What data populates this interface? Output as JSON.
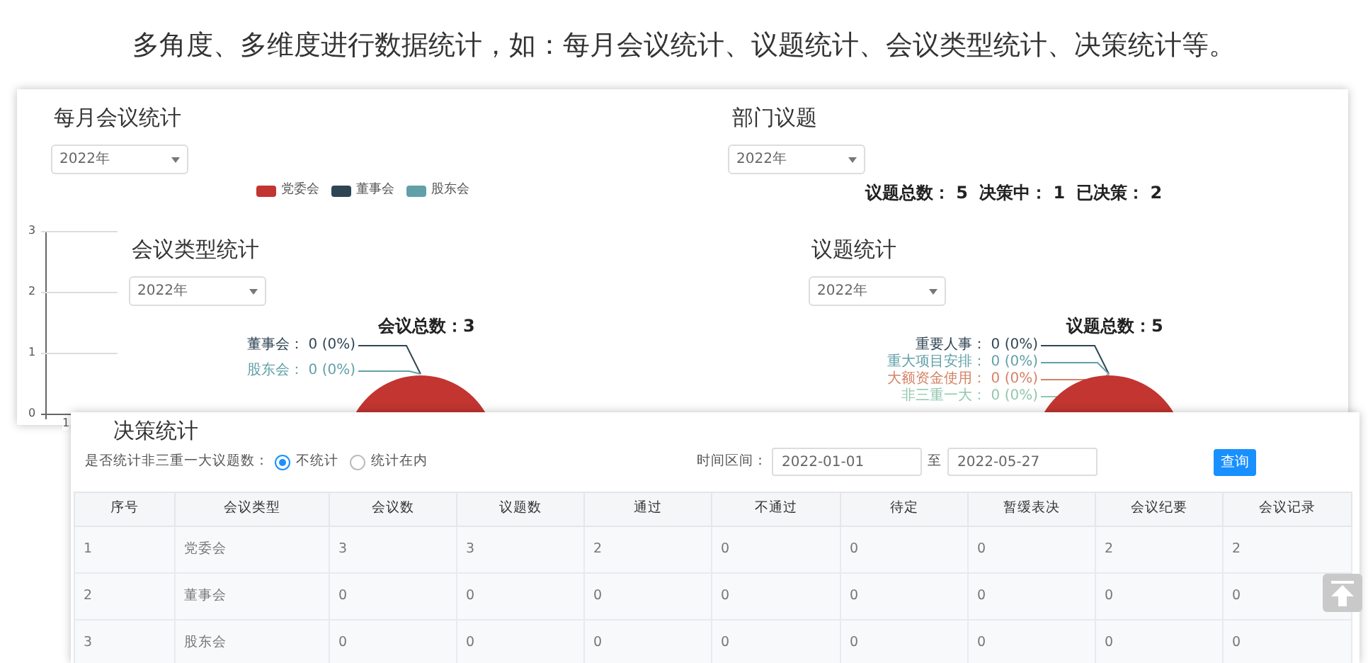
{
  "heading": "多角度、多维度进行数据统计，如：每月会议统计、议题统计、会议类型统计、决策统计等。",
  "monthly": {
    "title": "每月会议统计",
    "year_select": "2022年",
    "legend": [
      {
        "label": "党委会",
        "color": "#c23531"
      },
      {
        "label": "董事会",
        "color": "#2f4554"
      },
      {
        "label": "股东会",
        "color": "#61a0a8"
      }
    ],
    "y_axis_labels": [
      "3",
      "2",
      "1",
      "0"
    ],
    "x_axis_labels": [
      "1"
    ]
  },
  "department": {
    "title": "部门议题",
    "year_select": "2022年",
    "summary": [
      {
        "label": "议题总数：",
        "value": "5"
      },
      {
        "label": "决策中：",
        "value": "1"
      },
      {
        "label": "已决策：",
        "value": "2"
      }
    ]
  },
  "meeting_types": {
    "title": "会议类型统计",
    "year_select": "2022年",
    "total": "会议总数：3",
    "labels": [
      {
        "name": "董事会：",
        "value": "0 (0%)",
        "color": "#2f4554"
      },
      {
        "name": "股东会：",
        "value": "0 (0%)",
        "color": "#61a0a8"
      }
    ]
  },
  "topics": {
    "title": "议题统计",
    "year_select": "2022年",
    "total": "议题总数：5",
    "labels": [
      {
        "name": "重要人事：",
        "value": "0 (0%)",
        "color": "#2f4554"
      },
      {
        "name": "重大项目安排：",
        "value": "0 (0%)",
        "color": "#61a0a8"
      },
      {
        "name": "大额资金使用：",
        "value": "0 (0%)",
        "color": "#d48265"
      },
      {
        "name": "非三重一大：",
        "value": "0 (0%)",
        "color": "#91c7ae"
      }
    ]
  },
  "decisions": {
    "title": "决策统计",
    "filter_label": "是否统计非三重一大议题数：",
    "options": [
      {
        "label": "不统计",
        "selected": true
      },
      {
        "label": "统计在内",
        "selected": false
      }
    ],
    "range_label": "时间区间：",
    "start_date": "2022-01-01",
    "range_separator": "至",
    "end_date": "2022-05-27",
    "query_button": "查询",
    "table": {
      "columns": [
        "序号",
        "会议类型",
        "会议数",
        "议题数",
        "通过",
        "不通过",
        "待定",
        "暂缓表决",
        "会议纪要",
        "会议记录"
      ],
      "rows": [
        [
          "1",
          "党委会",
          "3",
          "3",
          "2",
          "0",
          "0",
          "0",
          "2",
          "2"
        ],
        [
          "2",
          "董事会",
          "0",
          "0",
          "0",
          "0",
          "0",
          "0",
          "0",
          "0"
        ],
        [
          "3",
          "股东会",
          "0",
          "0",
          "0",
          "0",
          "0",
          "0",
          "0",
          "0"
        ]
      ]
    }
  }
}
